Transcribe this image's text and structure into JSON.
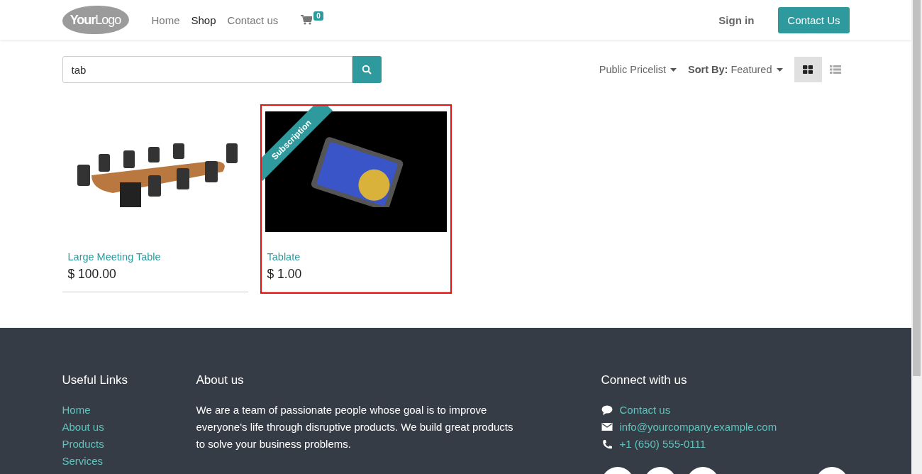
{
  "header": {
    "logo": {
      "bold": "Your",
      "light": "Logo"
    },
    "nav": [
      {
        "label": "Home",
        "selected": false
      },
      {
        "label": "Shop",
        "selected": true
      },
      {
        "label": "Contact us",
        "selected": false
      }
    ],
    "cart_count": "0",
    "sign_in": "Sign in",
    "cta": "Contact Us"
  },
  "search": {
    "value": "tab"
  },
  "pricelist": "Public Pricelist",
  "sort": {
    "label": "Sort By:",
    "value": "Featured"
  },
  "view_modes": [
    {
      "kind": "grid",
      "selected": true
    },
    {
      "kind": "list",
      "selected": false
    }
  ],
  "products": [
    {
      "name": "Large Meeting Table",
      "price": "$ 100.00",
      "kind": "table",
      "highlighted": false
    },
    {
      "name": "Tablate",
      "price": "$ 1.00",
      "kind": "tablet",
      "ribbon": "Subscription",
      "highlighted": true
    }
  ],
  "footer": {
    "links_title": "Useful Links",
    "links": [
      "Home",
      "About us",
      "Products",
      "Services"
    ],
    "about_title": "About us",
    "about_text": "We are a team of passionate people whose goal is to improve everyone's life through disruptive products. We build great products to solve your business problems.",
    "connect_title": "Connect with us",
    "contacts": [
      {
        "kind": "chat",
        "text": "Contact us"
      },
      {
        "kind": "mail",
        "text": "info@yourcompany.example.com"
      },
      {
        "kind": "phone",
        "text": "+1 (650) 555-0111"
      }
    ]
  }
}
